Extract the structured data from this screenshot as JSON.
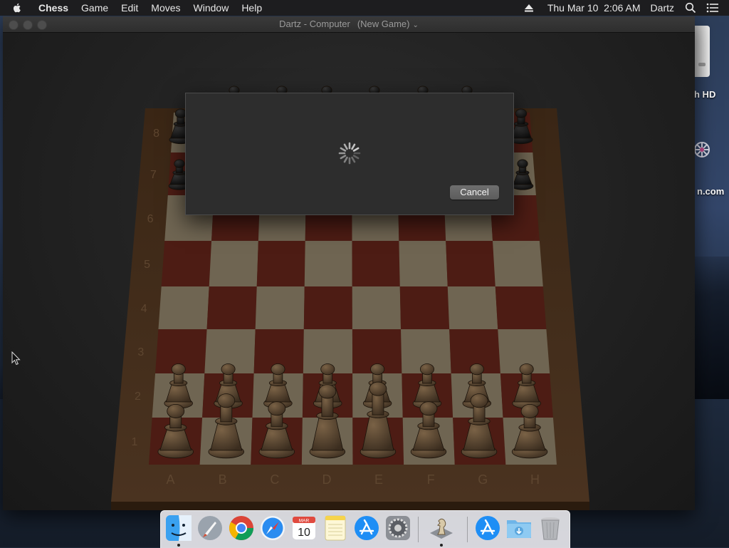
{
  "menubar": {
    "app_name": "Chess",
    "items": [
      "Game",
      "Edit",
      "Moves",
      "Window",
      "Help"
    ],
    "clock": "Thu Mar 10  2:06 AM",
    "user": "Dartz"
  },
  "desktop": {
    "labels": [
      "h HD",
      "n.com"
    ]
  },
  "window": {
    "title": "Dartz - Computer",
    "subtitle": "(New Game)"
  },
  "board": {
    "ranks": [
      "1",
      "2",
      "3",
      "4",
      "5",
      "6",
      "7",
      "8"
    ],
    "files": [
      "A",
      "B",
      "C",
      "D",
      "E",
      "F",
      "G",
      "H"
    ]
  },
  "dialog": {
    "cancel_label": "Cancel"
  },
  "dock": {
    "calendar_month": "MAR",
    "calendar_day": "10",
    "apps": [
      "finder-icon",
      "launchpad-icon",
      "chrome-icon",
      "safari-icon",
      "calendar-icon",
      "notes-icon",
      "app-store-icon",
      "system-preferences-icon",
      "chess-icon",
      "applications-folder-icon",
      "downloads-folder-icon",
      "trash-icon"
    ]
  }
}
